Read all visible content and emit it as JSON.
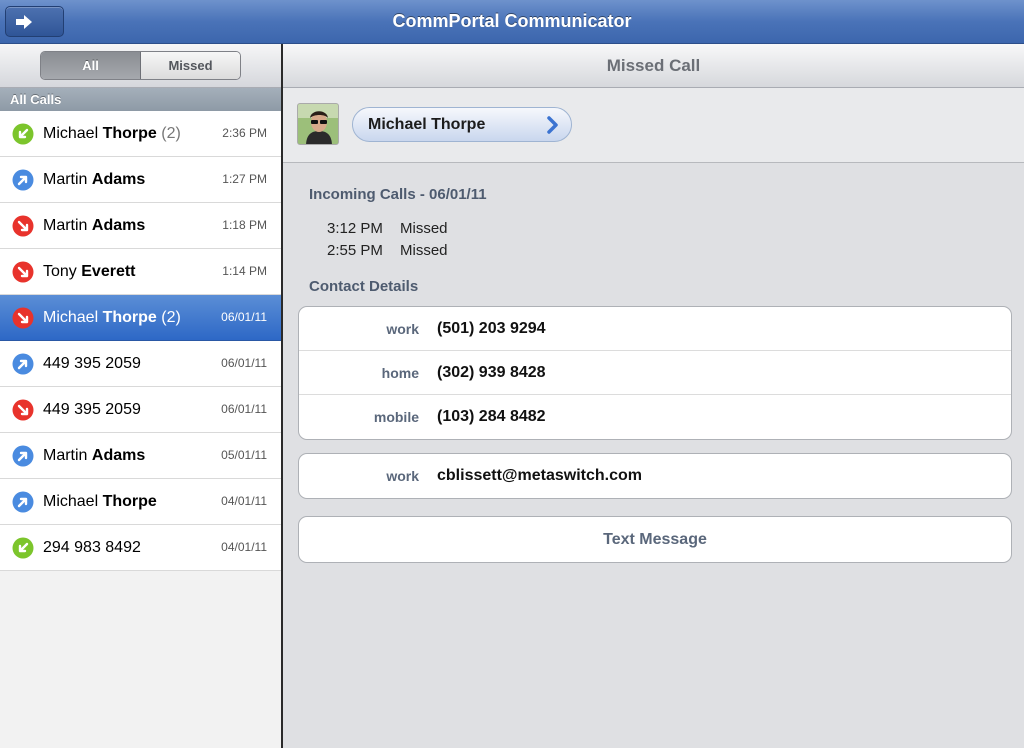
{
  "app": {
    "title": "CommPortal Communicator"
  },
  "filter": {
    "all_label": "All",
    "missed_label": "Missed"
  },
  "list": {
    "section_label": "All Calls",
    "items": [
      {
        "first": "Michael",
        "last": "Thorpe",
        "count": "(2)",
        "time": "2:36 PM",
        "type": "incoming",
        "selected": false
      },
      {
        "first": "Martin",
        "last": "Adams",
        "count": "",
        "time": "1:27 PM",
        "type": "outgoing",
        "selected": false
      },
      {
        "first": "Martin",
        "last": "Adams",
        "count": "",
        "time": "1:18 PM",
        "type": "missed",
        "selected": false
      },
      {
        "first": "Tony",
        "last": "Everett",
        "count": "",
        "time": "1:14 PM",
        "type": "missed",
        "selected": false
      },
      {
        "first": "Michael",
        "last": "Thorpe",
        "count": "(2)",
        "time": "06/01/11",
        "type": "missed",
        "selected": true
      },
      {
        "first": "449 395 2059",
        "last": "",
        "count": "",
        "time": "06/01/11",
        "type": "outgoing",
        "selected": false
      },
      {
        "first": "449 395 2059",
        "last": "",
        "count": "",
        "time": "06/01/11",
        "type": "missed",
        "selected": false
      },
      {
        "first": "Martin",
        "last": "Adams",
        "count": "",
        "time": "05/01/11",
        "type": "outgoing",
        "selected": false
      },
      {
        "first": "Michael",
        "last": "Thorpe",
        "count": "",
        "time": "04/01/11",
        "type": "outgoing",
        "selected": false
      },
      {
        "first": "294 983 8492",
        "last": "",
        "count": "",
        "time": "04/01/11",
        "type": "incoming",
        "selected": false
      }
    ]
  },
  "detail": {
    "header": "Missed Call",
    "contact_name": "Michael Thorpe",
    "calls_title": "Incoming Calls - 06/01/11",
    "calls": [
      {
        "time": "3:12 PM",
        "status": "Missed"
      },
      {
        "time": "2:55 PM",
        "status": "Missed"
      }
    ],
    "details_title": "Contact Details",
    "phones": [
      {
        "label": "work",
        "value": "(501) 203 9294"
      },
      {
        "label": "home",
        "value": "(302) 939 8428"
      },
      {
        "label": "mobile",
        "value": "(103) 284 8482"
      }
    ],
    "emails": [
      {
        "label": "work",
        "value": "cblissett@metaswitch.com"
      }
    ],
    "text_message_label": "Text Message"
  },
  "colors": {
    "incoming": "#7cc52c",
    "outgoing": "#4a8be0",
    "missed": "#e8332c",
    "topbar": "#4a73b8"
  },
  "icons": {
    "incoming": "incoming-call-arrow-icon",
    "outgoing": "outgoing-call-arrow-icon",
    "missed": "missed-call-arrow-icon"
  }
}
